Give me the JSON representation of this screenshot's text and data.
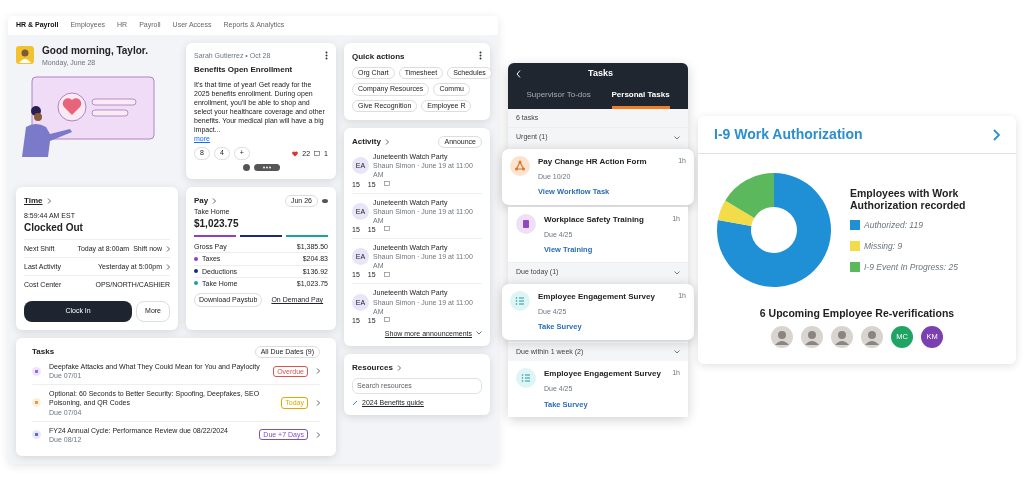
{
  "dashboard": {
    "nav": [
      {
        "label": "HR & Payroll",
        "selected": true
      },
      {
        "label": "Employees",
        "selected": false
      },
      {
        "label": "HR",
        "selected": false
      },
      {
        "label": "Payroll",
        "selected": false
      },
      {
        "label": "User Access",
        "selected": false
      },
      {
        "label": "Reports & Analytics",
        "selected": false
      }
    ],
    "greeting": {
      "title": "Good morning, Taylor.",
      "date": "Monday, June 28"
    },
    "post": {
      "author": "Sarah Gutierrez • Oct 28",
      "title": "Benefits Open Enrollment",
      "body": "It's that time of year! Get ready for the 2025 benefits enrollment. During open enrollment, you'll be able to shop and select your healthcare coverage and other benefits. Your medical plan will have a big impact...",
      "more": "more",
      "reactions": [
        "8",
        "4",
        "+"
      ],
      "likes": "22",
      "comments": "1"
    },
    "quick_actions": {
      "title": "Quick actions",
      "rows": [
        [
          "Org Chart",
          "Timesheet",
          "Schedules"
        ],
        [
          "Company Resources",
          "Commu"
        ],
        [
          "Give Recognition",
          "Employee R"
        ]
      ]
    },
    "time": {
      "title": "Time",
      "clock": "8:59:44 AM EST",
      "status": "Clocked Out",
      "rows": [
        {
          "label": "Next Shift",
          "value": "Today at 8:00am",
          "extra": "Shift now"
        },
        {
          "label": "Last Activity",
          "value": "Yesterday at 5:00pm"
        },
        {
          "label": "Cost Center",
          "value": "OPS/NORTH/CASHIER"
        }
      ],
      "buttons": [
        "Clock In",
        "More"
      ]
    },
    "pay": {
      "title": "Pay",
      "period": "Jun 26",
      "take_home_label": "Take Home",
      "take_home": "$1,023.75",
      "rows": [
        {
          "label": "Gross Pay",
          "value": "$1,385.50"
        },
        {
          "label": "Taxes",
          "value": "$204.83",
          "color": "#8e3fc9"
        },
        {
          "label": "Deductions",
          "value": "$136.92",
          "color": "#1d2a7a"
        },
        {
          "label": "Take Home",
          "value": "$1,023.75",
          "color": "#1aa39a"
        }
      ],
      "buttons": [
        "Download Paystub",
        "On Demand Pay"
      ]
    },
    "tasks": {
      "title": "Tasks",
      "filter": "All Due Dates (9)",
      "items": [
        {
          "title": "Deepfake Attacks and What They Could Mean for You and Paylocity",
          "due": "Due 07/01",
          "badge": "Overdue",
          "color": "#d9534f"
        },
        {
          "title": "Optional: 60 Seconds to Better Security: Spoofing, Deepfakes, SEO Poisoning, and QR Codes",
          "due": "Due 07/04",
          "badge": "Today",
          "color": "#e0a800"
        },
        {
          "title": "FY24 Annual Cycle: Performance Review due 08/22/2024",
          "due": "Due 08/12",
          "badge": "Due +7 Days",
          "color": "#7b4fc9"
        }
      ]
    },
    "activity": {
      "title": "Activity",
      "filter": "Announce",
      "items": [
        {
          "initials": "EA",
          "title": "Juneteenth Watch Party",
          "meta": "Shaun Simon · June 19 at 11:00 AM",
          "likes": "15",
          "claps": "15"
        },
        {
          "initials": "EA",
          "title": "Juneteenth Watch Party",
          "meta": "Shaun Simon · June 19 at 11:00 AM",
          "likes": "15",
          "claps": "15"
        },
        {
          "initials": "EA",
          "title": "Juneteenth Watch Party",
          "meta": "Shaun Simon · June 19 at 11:00 AM",
          "likes": "15",
          "claps": "15"
        },
        {
          "initials": "EA",
          "title": "Juneteenth Watch Party",
          "meta": "Shaun Simon · June 19 at 11:00 AM",
          "likes": "15",
          "claps": "15"
        }
      ],
      "more": "Show more announcements"
    },
    "resources": {
      "title": "Resources",
      "search": {
        "placeholder": "Search resources"
      },
      "items": [
        "2024 Benefits guide"
      ]
    }
  },
  "tasks_panel": {
    "title": "Tasks",
    "tabs": [
      {
        "label": "Supervisor To-dos",
        "selected": false
      },
      {
        "label": "Personal Tasks",
        "selected": true
      }
    ],
    "count": "6 tasks",
    "groups": [
      {
        "title": "Urgent (1)",
        "items": [
          {
            "kind": "workflow",
            "title": "Pay Change HR Action Form",
            "due": "Due 10/20",
            "action": "View Workflow Task",
            "age": "1h",
            "elevated": true
          },
          {
            "kind": "training",
            "title": "Workplace Safety Training",
            "due": "Due 4/25",
            "action": "View Training",
            "age": "1h",
            "elevated": false
          }
        ]
      },
      {
        "title": "Due today (1)",
        "items": [
          {
            "kind": "survey",
            "title": "Employee Engagement Survey",
            "due": "Due 4/25",
            "action": "Take Survey",
            "age": "1h",
            "elevated": true
          }
        ]
      },
      {
        "title": "Due within 1 week (2)",
        "items": [
          {
            "kind": "survey",
            "title": "Employee Engagement Survey",
            "due": "Due 4/25",
            "action": "Take Survey",
            "age": "1h",
            "elevated": false
          }
        ]
      }
    ]
  },
  "i9": {
    "title": "I-9 Work Authorization",
    "chart_data": {
      "type": "donut",
      "title": "Employees with Work Authorization recorded",
      "categories": [
        "Authorized: 119",
        "Missing: 9",
        "I-9 Event In Progress: 25"
      ],
      "values": [
        119,
        9,
        25
      ],
      "colors": [
        "#1f8fd6",
        "#f2dc4a",
        "#5cb85c"
      ]
    },
    "reverifications": {
      "title": "6 Upcoming Employee Re-verifications",
      "people": [
        {
          "kind": "photo"
        },
        {
          "kind": "photo"
        },
        {
          "kind": "photo"
        },
        {
          "kind": "photo"
        },
        {
          "kind": "initials",
          "initials": "MC",
          "color": "#1fa463"
        },
        {
          "kind": "initials",
          "initials": "KM",
          "color": "#7a3fb0"
        }
      ]
    }
  }
}
